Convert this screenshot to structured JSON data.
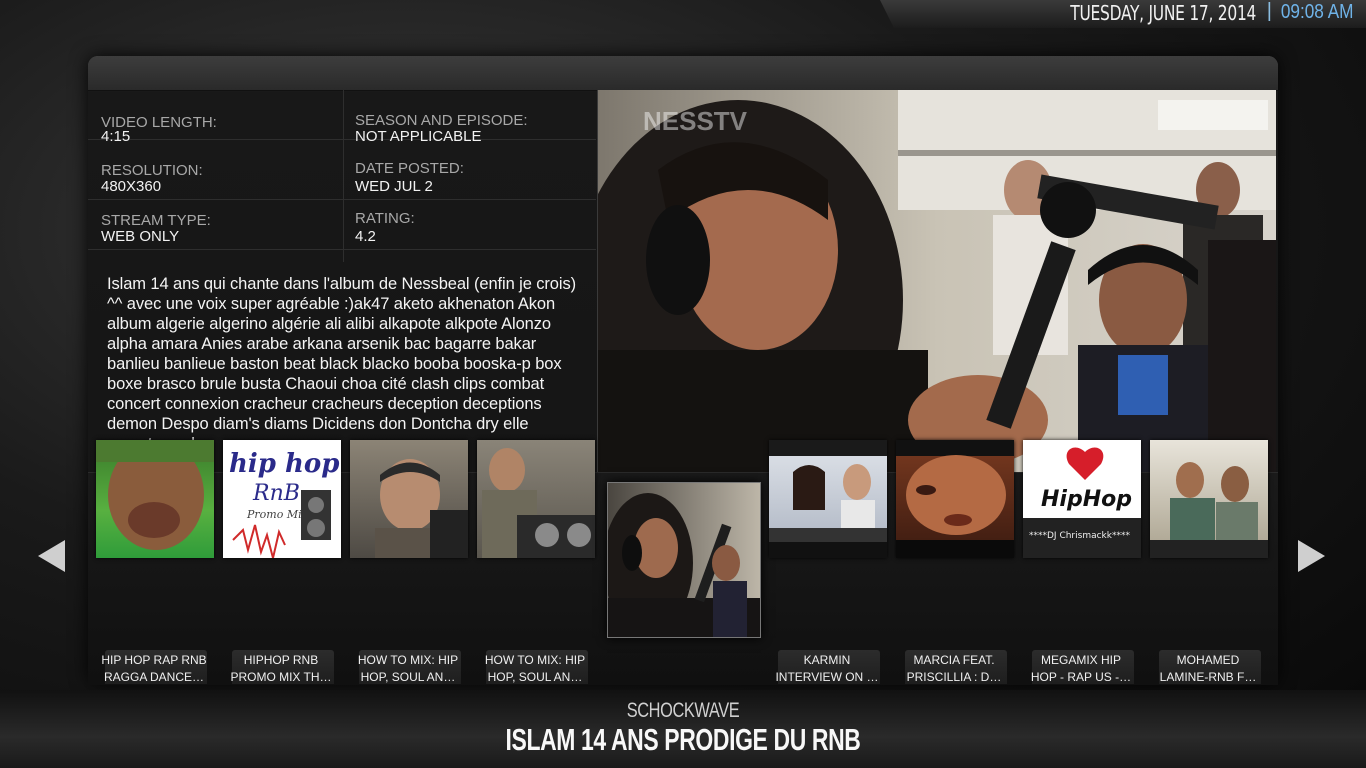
{
  "clock": {
    "date": "TUESDAY, JUNE 17, 2014",
    "separator": "|",
    "time": "09:08 AM"
  },
  "info": {
    "video_length_label": "VIDEO LENGTH:",
    "video_length": "4:15",
    "season_label": "SEASON AND EPISODE:",
    "season": "NOT APPLICABLE",
    "resolution_label": "RESOLUTION:",
    "resolution": "480X360",
    "date_posted_label": "DATE POSTED:",
    "date_posted": "WED JUL 2",
    "stream_type_label": "STREAM TYPE:",
    "stream_type": "WEB ONLY",
    "rating_label": "RATING:",
    "rating": "4.2"
  },
  "description": "Islam 14 ans qui chante dans l'album de Nessbeal (enfin je crois) ^^ avec une voix super agréable :)ak47 aketo akhenaton Akon album algerie algerino algérie ali alibi alkapote alkpote Alonzo alpha amara Anies arabe arkana arsenik bac bagarre bakar banlieu banlieue baston beat black blacko booba booska-p box boxe brasco brule busta Chaoui choa cité clash clips combat concert connexion cracheur cracheurs deception deceptions demon Despo diam's diams Dicidens don Dontcha dry elle emeute excl…",
  "video": {
    "watermark": "NESSTV"
  },
  "thumbnails": [
    {
      "label": "HIP HOP RAP RNB\nRAGGA DANCE…"
    },
    {
      "label": "HIPHOP RNB\nPROMO MIX TH…",
      "art_line1": "hip hop",
      "art_line2": "RnB",
      "art_line3": "Promo Mix"
    },
    {
      "label": "HOW TO MIX: HIP\nHOP, SOUL AN…"
    },
    {
      "label": "HOW TO MIX: HIP\nHOP, SOUL AN…"
    },
    {
      "label": ""
    },
    {
      "label": "KARMIN\nINTERVIEW ON …"
    },
    {
      "label": "MARCIA FEAT.\nPRISCILLIA : D…"
    },
    {
      "label": "MEGAMIX HIP\nHOP - RAP US -…",
      "art_line1": "HipHop",
      "art_line2": "****DJ Chrismackk****"
    },
    {
      "label": "MOHAMED\nLAMINE-RNB F…"
    }
  ],
  "channel": "SCHOCKWAVE",
  "title": "ISLAM 14 ANS PRODIGE DU RNB"
}
